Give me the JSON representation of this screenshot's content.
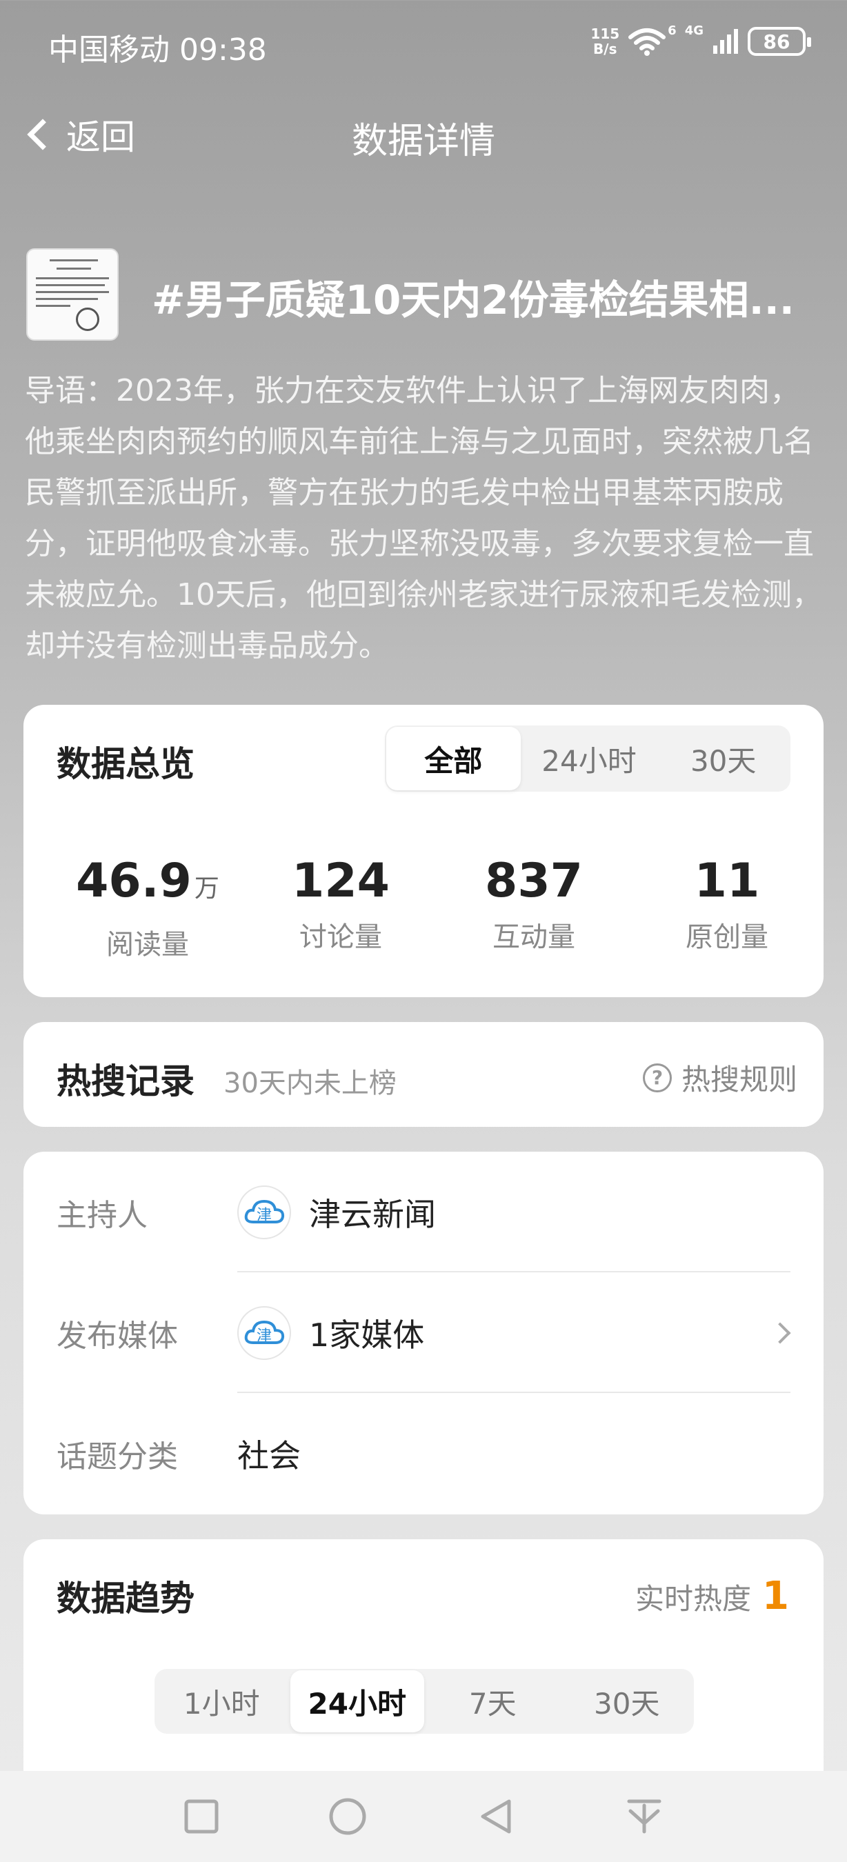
{
  "status_bar": {
    "carrier_time": "中国移动 09:38",
    "net_speed_value": "115",
    "net_speed_unit": "B/s",
    "wifi_level": "6",
    "cell_type": "4G",
    "battery": "86"
  },
  "nav": {
    "back_label": "返回",
    "title": "数据详情"
  },
  "topic": {
    "title": "#男子质疑10天内2份毒检结果相...",
    "intro": "导语：2023年，张力在交友软件上认识了上海网友肉肉，他乘坐肉肉预约的顺风车前往上海与之见面时，突然被几名民警抓至派出所，警方在张力的毛发中检出甲基苯丙胺成分，证明他吸食冰毒。张力坚称没吸毒，多次要求复检一直未被应允。10天后，他回到徐州老家进行尿液和毛发检测，却并没有检测出毒品成分。"
  },
  "overview": {
    "title": "数据总览",
    "tabs": [
      "全部",
      "24小时",
      "30天"
    ],
    "active_tab": "全部",
    "stats": [
      {
        "value": "46.9",
        "unit": "万",
        "label": "阅读量"
      },
      {
        "value": "124",
        "unit": "",
        "label": "讨论量"
      },
      {
        "value": "837",
        "unit": "",
        "label": "互动量"
      },
      {
        "value": "11",
        "unit": "",
        "label": "原创量"
      }
    ]
  },
  "hot_search": {
    "title": "热搜记录",
    "note": "30天内未上榜",
    "rule_label": "热搜规则",
    "rule_icon": "?"
  },
  "info": {
    "host_label": "主持人",
    "host_value": "津云新闻",
    "media_label": "发布媒体",
    "media_value": "1家媒体",
    "category_label": "话题分类",
    "category_value": "社会",
    "logo_glyph": "津"
  },
  "trend": {
    "title": "数据趋势",
    "heat_label": "实时热度",
    "heat_value": "1",
    "tabs": [
      "1小时",
      "24小时",
      "7天",
      "30天"
    ],
    "active_tab": "24小时"
  },
  "colors": {
    "accent_orange": "#f08a00",
    "logo_blue": "#2f8fd8"
  }
}
